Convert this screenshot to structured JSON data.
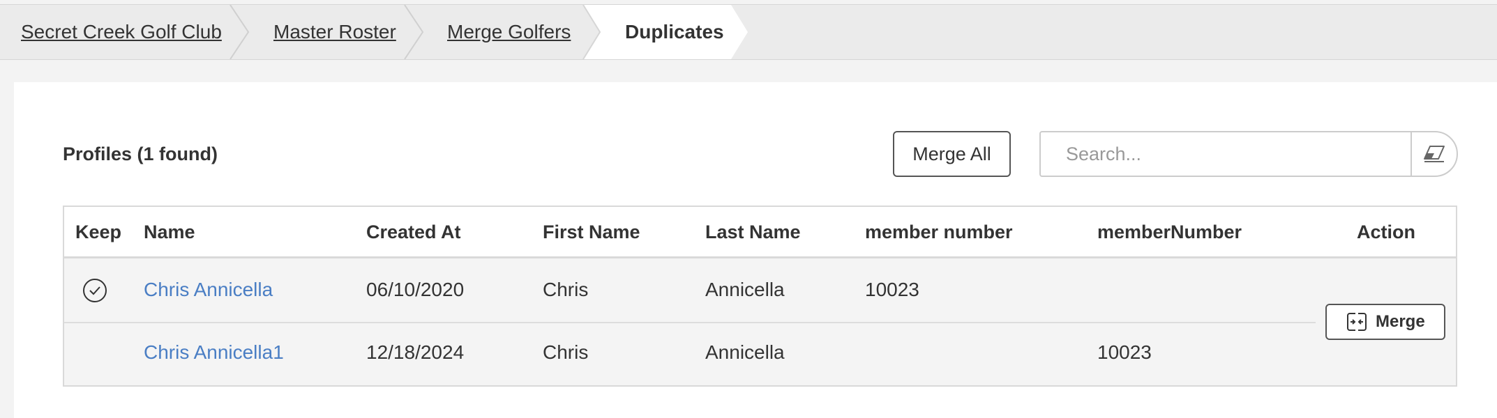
{
  "breadcrumb": {
    "items": [
      {
        "label": "Secret Creek Golf Club"
      },
      {
        "label": "Master Roster"
      },
      {
        "label": "Merge Golfers"
      },
      {
        "label": "Duplicates"
      }
    ]
  },
  "profiles": {
    "title": "Profiles (1 found)",
    "merge_all_label": "Merge All",
    "search_placeholder": "Search..."
  },
  "table": {
    "columns": [
      "Keep",
      "Name",
      "Created At",
      "First Name",
      "Last Name",
      "member number",
      "memberNumber",
      "Action"
    ],
    "rows": [
      {
        "keep": true,
        "name": "Chris Annicella",
        "created_at": "06/10/2020",
        "first_name": "Chris",
        "last_name": "Annicella",
        "member_number": "10023",
        "memberNumber": ""
      },
      {
        "keep": false,
        "name": "Chris Annicella1",
        "created_at": "12/18/2024",
        "first_name": "Chris",
        "last_name": "Annicella",
        "member_number": "",
        "memberNumber": "10023"
      }
    ],
    "merge_label": "Merge"
  },
  "icons": {
    "keep": "check-circle-icon",
    "merge": "merge-arrows-icon",
    "clear_search": "eraser-icon"
  },
  "colors": {
    "link": "#4a7ec4",
    "breadcrumb_bg": "#ebebeb",
    "active_crumb_bg": "#ffffff"
  }
}
